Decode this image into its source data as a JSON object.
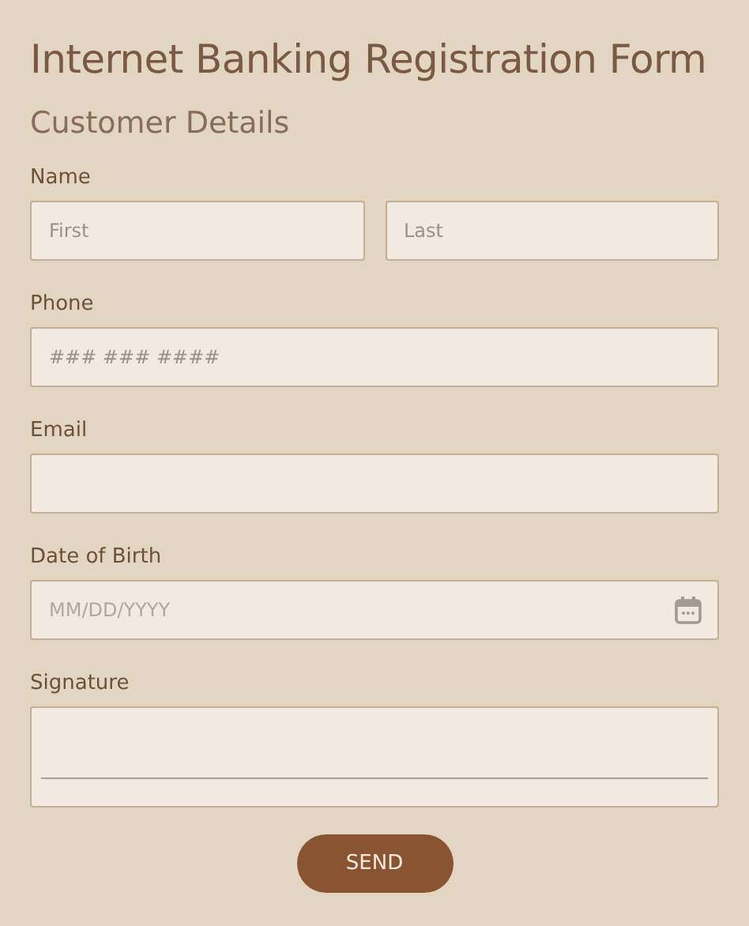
{
  "title": "Internet Banking Registration Form",
  "section": "Customer Details",
  "fields": [
    {
      "kind": "name",
      "label": "Name",
      "inputs": [
        {
          "placeholder": "First"
        },
        {
          "placeholder": "Last"
        }
      ]
    },
    {
      "kind": "text",
      "label": "Phone",
      "placeholder": "### ### ####"
    },
    {
      "kind": "text",
      "label": "Email"
    },
    {
      "kind": "date",
      "label": "Date of Birth",
      "placeholder": "MM/DD/YYYY"
    },
    {
      "kind": "signature",
      "label": "Signature"
    }
  ],
  "submit": "SEND"
}
